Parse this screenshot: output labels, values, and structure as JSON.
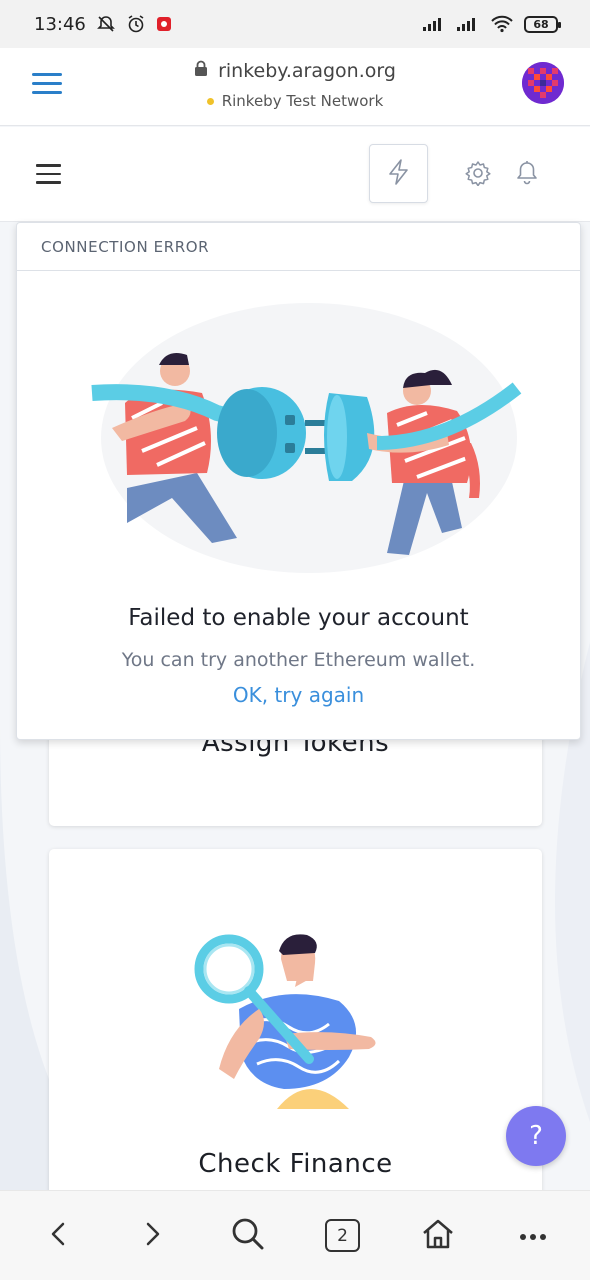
{
  "status_bar": {
    "time": "13:46",
    "battery": "68"
  },
  "browser": {
    "url": "rinkeby.aragon.org",
    "network": "Rinkeby Test Network",
    "tab_count": "2"
  },
  "app": {
    "cards": [
      {
        "title": "Assign Tokens"
      },
      {
        "title": "Check Finance"
      }
    ],
    "help_label": "?"
  },
  "error_panel": {
    "header": "CONNECTION ERROR",
    "title": "Failed to enable your account",
    "subtitle": "You can try another Ethereum wallet.",
    "action": "OK, try again"
  },
  "colors": {
    "accent": "#3a8fdc",
    "browser_menu": "#2a7fc9",
    "help_button": "#7e79f0",
    "network_dot": "#f0c22a"
  }
}
